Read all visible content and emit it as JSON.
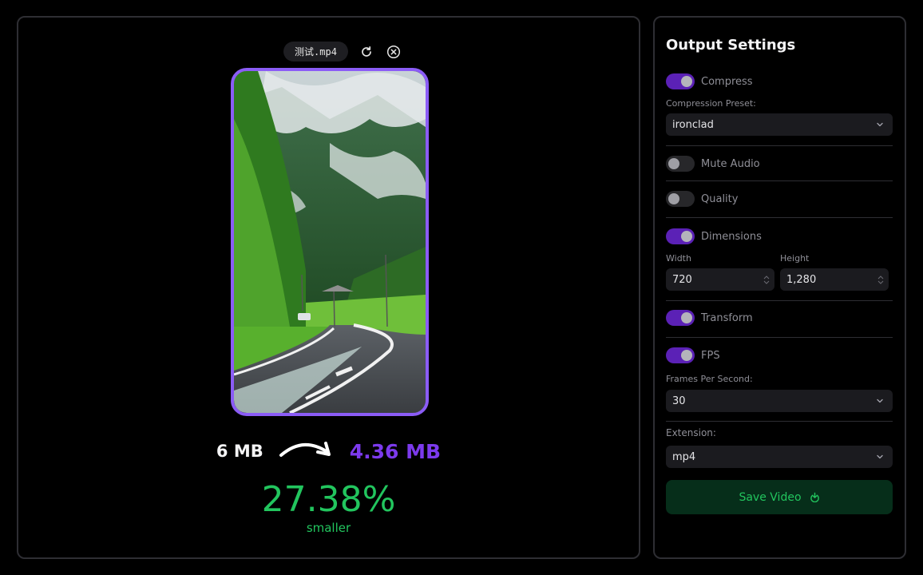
{
  "file": {
    "name": "测试.mp4"
  },
  "result": {
    "size_before": "6 MB",
    "size_after": "4.36 MB",
    "percent": "27.38%",
    "percent_caption": "smaller"
  },
  "settings": {
    "title": "Output Settings",
    "compress": {
      "label": "Compress",
      "on": true
    },
    "preset_label": "Compression Preset:",
    "preset_value": "ironclad",
    "mute": {
      "label": "Mute Audio",
      "on": false
    },
    "quality": {
      "label": "Quality",
      "on": false
    },
    "dimensions": {
      "label": "Dimensions",
      "on": true
    },
    "width_label": "Width",
    "width_value": "720",
    "height_label": "Height",
    "height_value": "1,280",
    "transform": {
      "label": "Transform",
      "on": true
    },
    "fps": {
      "label": "FPS",
      "on": true
    },
    "fps_field_label": "Frames Per Second:",
    "fps_value": "30",
    "extension_label": "Extension:",
    "extension_value": "mp4",
    "save_label": "Save Video"
  },
  "colors": {
    "accent": "#8b5cf6",
    "success": "#22c55e",
    "toggle_on": "#5b21b6"
  },
  "icons": [
    "refresh-icon",
    "close-circle-icon",
    "chevron-down-icon",
    "download-icon",
    "arrow-icon"
  ]
}
